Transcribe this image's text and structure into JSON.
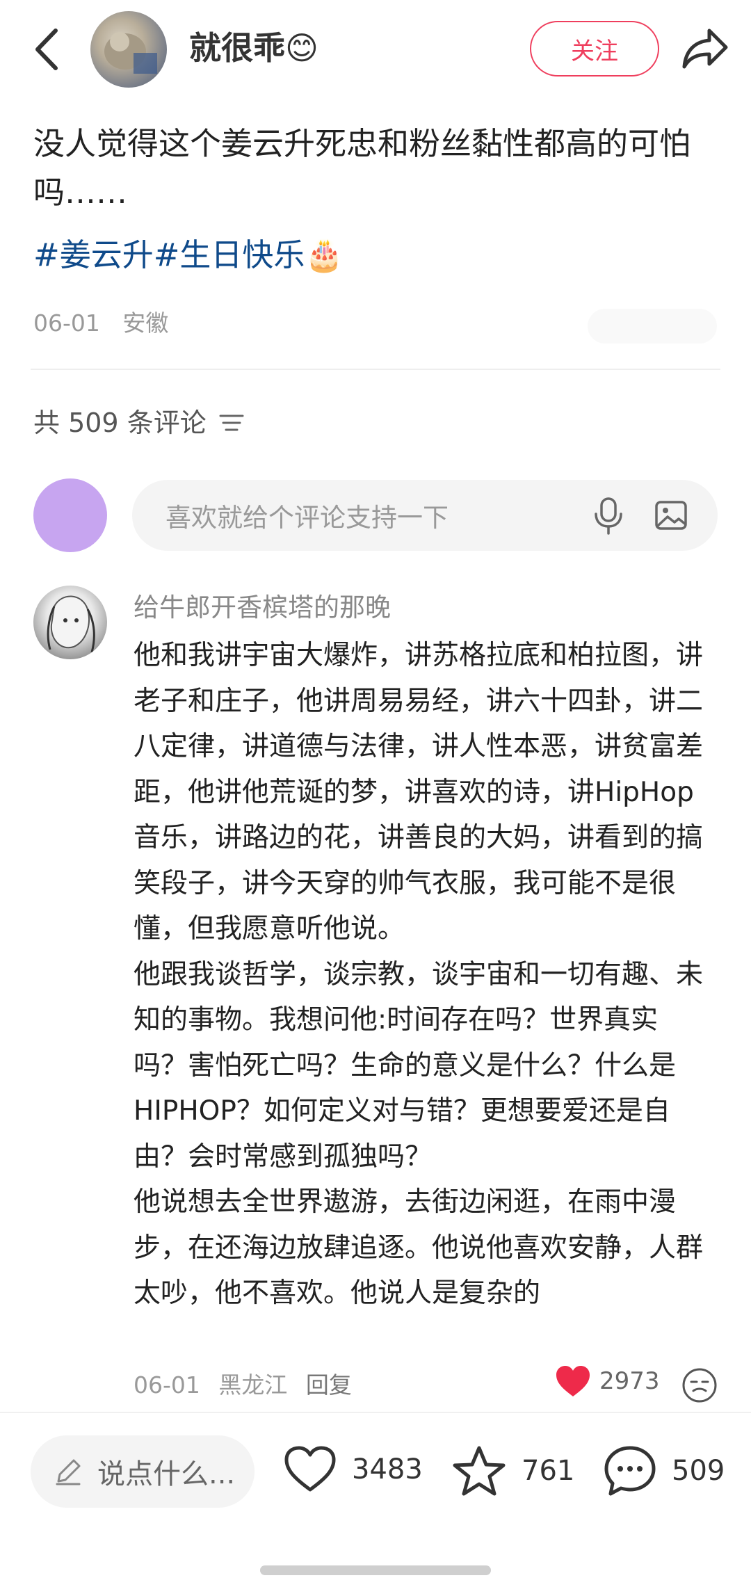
{
  "header": {
    "author": "就很乖😊",
    "follow_label": "关注"
  },
  "post": {
    "text": "没人觉得这个姜云升死忠和粉丝黏性都高的可怕吗……",
    "tags": "#姜云升#生日快乐🎂",
    "date": "06-01",
    "location": "安徽"
  },
  "comments_header": {
    "count_text": "共 509 条评论"
  },
  "comment_input": {
    "placeholder": "喜欢就给个评论支持一下"
  },
  "comment": {
    "username": "给牛郎开香槟塔的那晚",
    "paragraphs": [
      "他和我讲宇宙大爆炸，讲苏格拉底和柏拉图，讲老子和庄子，他讲周易易经，讲六十四卦，讲二八定律，讲道德与法律，讲人性本恶，讲贫富差距，他讲他荒诞的梦，讲喜欢的诗，讲HipHop音乐，讲路边的花，讲善良的大妈，讲看到的搞笑段子，讲今天穿的帅气衣服，我可能不是很懂，但我愿意听他说。",
      "他跟我谈哲学，谈宗教，谈宇宙和一切有趣、未知的事物。我想问他:时间存在吗？世界真实吗？害怕死亡吗？生命的意义是什么？什么是HIPHOP？如何定义对与错？更想要爱还是自由？会时常感到孤独吗？",
      "他说想去全世界遨游，去街边闲逛，在雨中漫步，在还海边放肆追逐。他说他喜欢安静，人群太吵，他不喜欢。他说人是复杂的"
    ],
    "date": "06-01",
    "location": "黑龙江",
    "reply_label": "回复",
    "likes": "2973"
  },
  "bottom_bar": {
    "say_placeholder": "说点什么...",
    "likes": "3483",
    "stars": "761",
    "comments": "509"
  },
  "colors": {
    "accent": "#ef3e5d",
    "tag": "#0f4a8a",
    "liked_heart": "#ee2a4a"
  }
}
